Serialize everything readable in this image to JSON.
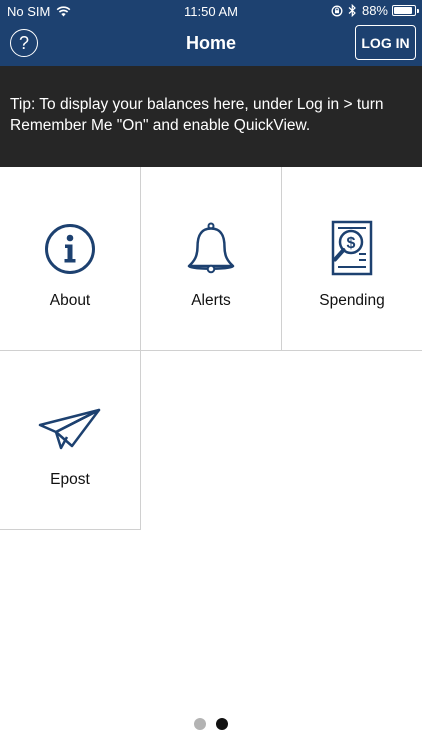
{
  "status_bar": {
    "carrier": "No SIM",
    "time": "11:50 AM",
    "battery": "88%"
  },
  "nav": {
    "help_symbol": "?",
    "title": "Home",
    "login_label": "LOG IN"
  },
  "tip": {
    "text": "Tip: To display your balances here, under Log in > turn Remember Me \"On\" and enable QuickView."
  },
  "tiles": [
    {
      "label": "About",
      "icon": "info-icon"
    },
    {
      "label": "Alerts",
      "icon": "bell-icon"
    },
    {
      "label": "Spending",
      "icon": "spending-report-icon"
    },
    {
      "label": "Epost",
      "icon": "paper-plane-icon"
    }
  ],
  "pager": {
    "page_count": 2,
    "active_page": 2
  },
  "colors": {
    "header": "#1d4170",
    "tip_background": "#262626",
    "icon": "#1d4170",
    "tile_border": "#d0d0d0"
  }
}
